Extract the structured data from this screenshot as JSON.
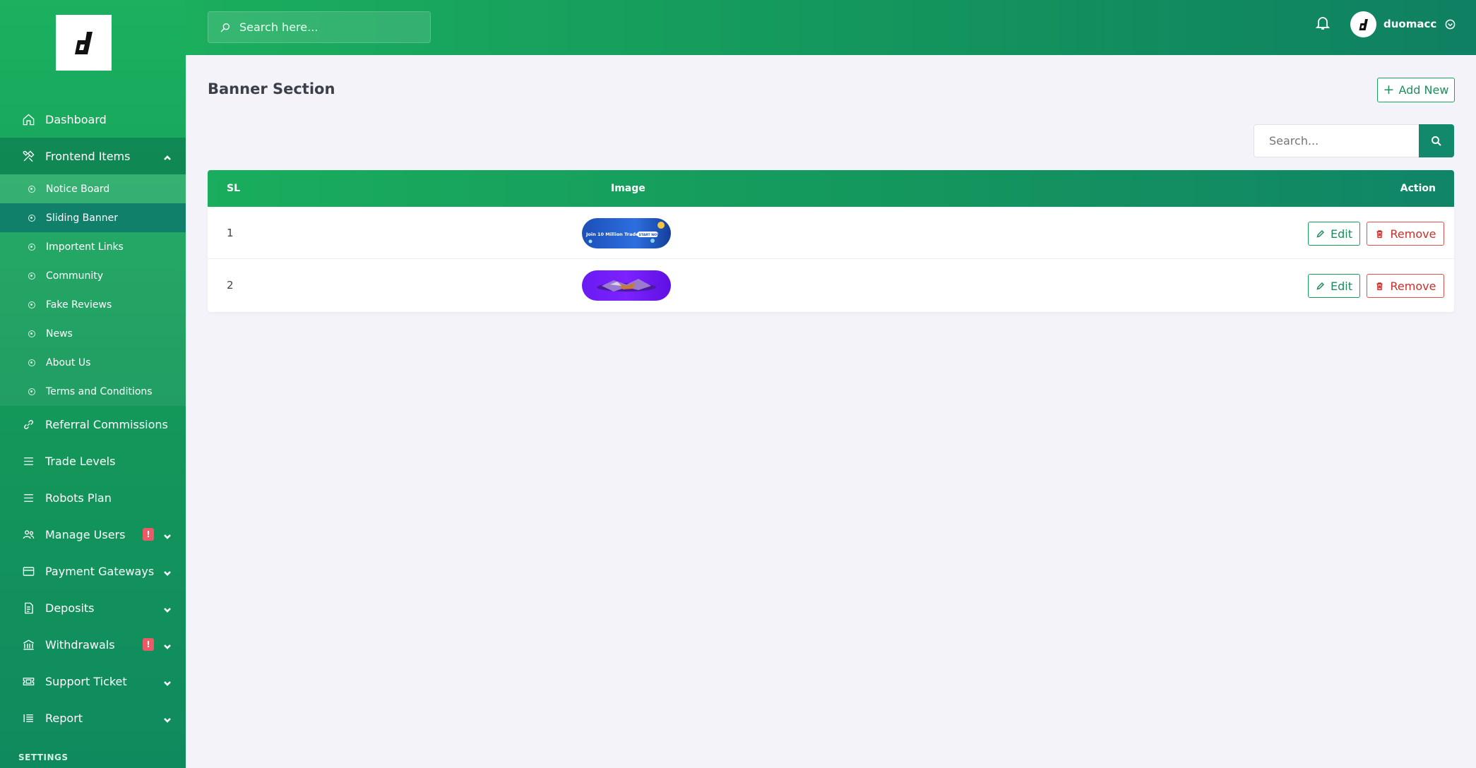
{
  "sidebar": {
    "items": [
      {
        "label": "Dashboard",
        "icon": "home-icon"
      },
      {
        "label": "Frontend Items",
        "icon": "tools-icon"
      },
      {
        "label": "Referral Commissions",
        "icon": "link-icon"
      },
      {
        "label": "Trade Levels",
        "icon": "menu-icon"
      },
      {
        "label": "Robots Plan",
        "icon": "menu-icon"
      },
      {
        "label": "Manage Users",
        "icon": "users-icon",
        "alert": "!"
      },
      {
        "label": "Payment Gateways",
        "icon": "credit-card-icon"
      },
      {
        "label": "Deposits",
        "icon": "receipt-icon"
      },
      {
        "label": "Withdrawals",
        "icon": "bank-icon",
        "alert": "!"
      },
      {
        "label": "Support Ticket",
        "icon": "ticket-icon"
      },
      {
        "label": "Report",
        "icon": "list-icon"
      }
    ],
    "subitems": [
      {
        "label": "Notice Board"
      },
      {
        "label": "Sliding Banner"
      },
      {
        "label": "Importent Links"
      },
      {
        "label": "Community"
      },
      {
        "label": "Fake Reviews"
      },
      {
        "label": "News"
      },
      {
        "label": "About Us"
      },
      {
        "label": "Terms and Conditions"
      }
    ],
    "settings_label": "SETTINGS"
  },
  "header": {
    "search_placeholder": "Search here...",
    "username": "duomacc"
  },
  "main": {
    "title": "Banner Section",
    "add_new_label": "Add New",
    "search_placeholder": "Search...",
    "table": {
      "columns": [
        "SL",
        "Image",
        "Action"
      ],
      "rows": [
        {
          "sl": "1",
          "banner_text": "Join 10 Million Traders",
          "banner_cta": "START NOW"
        },
        {
          "sl": "2"
        }
      ],
      "edit_label": "Edit",
      "remove_label": "Remove"
    }
  },
  "colors": {
    "brand_green": "#1bb15f",
    "dark_teal": "#0f8063",
    "danger": "#d9534f"
  }
}
